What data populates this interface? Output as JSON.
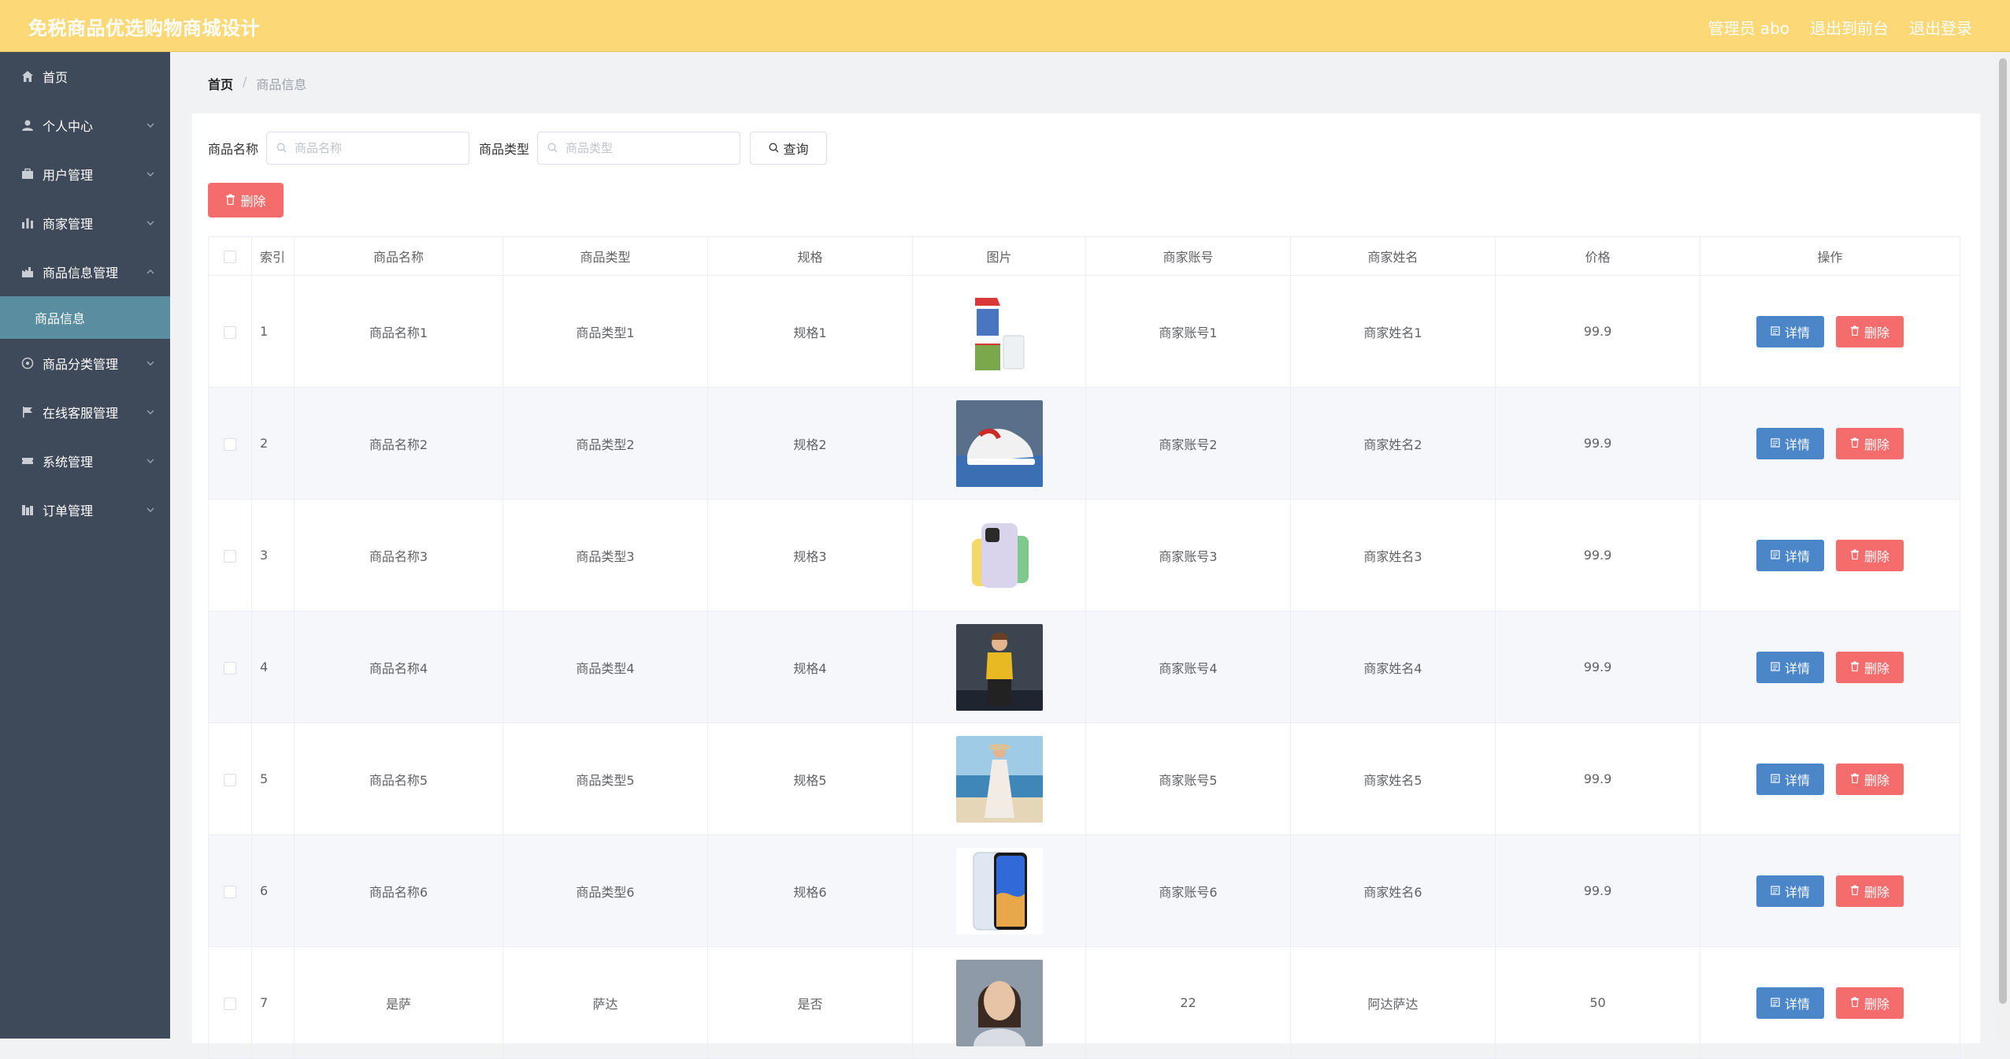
{
  "header": {
    "title": "免税商品优选购物商城设计",
    "links": [
      "管理员 abo",
      "退出到前台",
      "退出登录"
    ]
  },
  "sidebar": {
    "items": [
      {
        "label": "首页",
        "icon": "home-icon",
        "expandable": false
      },
      {
        "label": "个人中心",
        "icon": "user-icon",
        "expandable": true
      },
      {
        "label": "用户管理",
        "icon": "briefcase-icon",
        "expandable": true
      },
      {
        "label": "商家管理",
        "icon": "bar-chart-icon",
        "expandable": true
      },
      {
        "label": "商品信息管理",
        "icon": "factory-icon",
        "expandable": true,
        "expanded": true
      },
      {
        "label": "商品分类管理",
        "icon": "compass-icon",
        "expandable": true
      },
      {
        "label": "在线客服管理",
        "icon": "flag-icon",
        "expandable": true
      },
      {
        "label": "系统管理",
        "icon": "ticket-icon",
        "expandable": true
      },
      {
        "label": "订单管理",
        "icon": "columns-icon",
        "expandable": true
      }
    ],
    "active_sub": "商品信息"
  },
  "breadcrumb": {
    "home": "首页",
    "sep": "/",
    "current": "商品信息"
  },
  "search": {
    "name_label": "商品名称",
    "name_placeholder": "商品名称",
    "type_label": "商品类型",
    "type_placeholder": "商品类型",
    "query_label": "查询"
  },
  "bulk_delete_label": "删除",
  "table": {
    "headers": [
      "索引",
      "商品名称",
      "商品类型",
      "规格",
      "图片",
      "商家账号",
      "商家姓名",
      "价格",
      "操作"
    ],
    "rows": [
      {
        "index": "1",
        "name": "商品名称1",
        "type": "商品类型1",
        "spec": "规格1",
        "image": "milk-carton",
        "account": "商家账号1",
        "merchant": "商家姓名1",
        "price": "99.9"
      },
      {
        "index": "2",
        "name": "商品名称2",
        "type": "商品类型2",
        "spec": "规格2",
        "image": "sneaker",
        "account": "商家账号2",
        "merchant": "商家姓名2",
        "price": "99.9"
      },
      {
        "index": "3",
        "name": "商品名称3",
        "type": "商品类型3",
        "spec": "规格3",
        "image": "phone-colors",
        "account": "商家账号3",
        "merchant": "商家姓名3",
        "price": "99.9"
      },
      {
        "index": "4",
        "name": "商品名称4",
        "type": "商品类型4",
        "spec": "规格4",
        "image": "fashion-yellow",
        "account": "商家账号4",
        "merchant": "商家姓名4",
        "price": "99.9"
      },
      {
        "index": "5",
        "name": "商品名称5",
        "type": "商品类型5",
        "spec": "规格5",
        "image": "beach-dress",
        "account": "商家账号5",
        "merchant": "商家姓名5",
        "price": "99.9"
      },
      {
        "index": "6",
        "name": "商品名称6",
        "type": "商品类型6",
        "spec": "规格6",
        "image": "smartphone",
        "account": "商家账号6",
        "merchant": "商家姓名6",
        "price": "99.9"
      },
      {
        "index": "7",
        "name": "是萨",
        "type": "萨达",
        "spec": "是否",
        "image": "portrait",
        "account": "22",
        "merchant": "阿达萨达",
        "price": "50"
      }
    ],
    "detail_label": "详情",
    "delete_label": "删除"
  },
  "colors": {
    "header_bg": "#fdd877",
    "sidebar_bg": "#3e4959",
    "sidebar_active": "#5b8da1",
    "danger": "#f56c6c",
    "primary": "#4a86c8"
  }
}
